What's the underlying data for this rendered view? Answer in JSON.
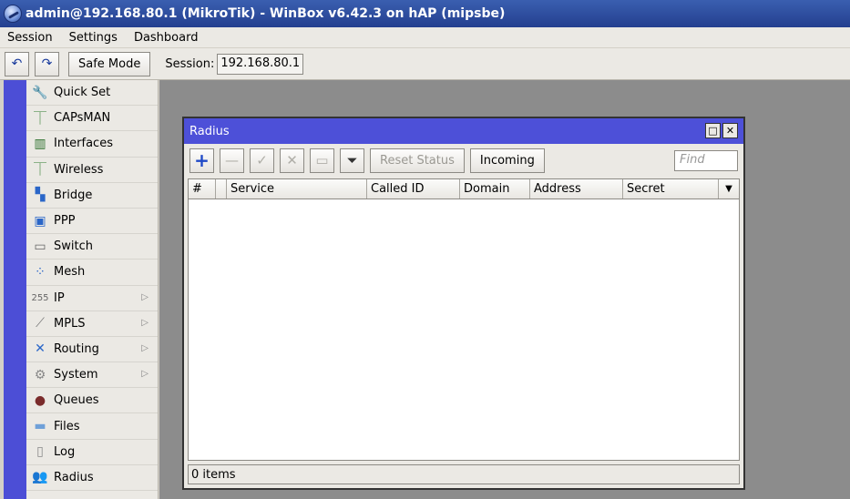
{
  "window_title": "admin@192.168.80.1 (MikroTik) - WinBox v6.42.3 on hAP (mipsbe)",
  "menu": [
    "Session",
    "Settings",
    "Dashboard"
  ],
  "toolbar": {
    "safe_mode": "Safe Mode",
    "session_label": "Session:",
    "session_value": "192.168.80.1"
  },
  "sidebar": {
    "items": [
      {
        "label": "Quick Set",
        "icon": "quickset-icon"
      },
      {
        "label": "CAPsMAN",
        "icon": "capsman-icon"
      },
      {
        "label": "Interfaces",
        "icon": "interfaces-icon"
      },
      {
        "label": "Wireless",
        "icon": "wireless-icon"
      },
      {
        "label": "Bridge",
        "icon": "bridge-icon"
      },
      {
        "label": "PPP",
        "icon": "ppp-icon"
      },
      {
        "label": "Switch",
        "icon": "switch-icon"
      },
      {
        "label": "Mesh",
        "icon": "mesh-icon"
      },
      {
        "label": "IP",
        "icon": "ip-icon",
        "submenu": true
      },
      {
        "label": "MPLS",
        "icon": "mpls-icon",
        "submenu": true
      },
      {
        "label": "Routing",
        "icon": "routing-icon",
        "submenu": true
      },
      {
        "label": "System",
        "icon": "system-icon",
        "submenu": true
      },
      {
        "label": "Queues",
        "icon": "queues-icon"
      },
      {
        "label": "Files",
        "icon": "files-icon"
      },
      {
        "label": "Log",
        "icon": "log-icon"
      },
      {
        "label": "Radius",
        "icon": "radius-icon"
      }
    ]
  },
  "radius_window": {
    "title": "Radius",
    "buttons": {
      "reset_status": "Reset Status",
      "incoming": "Incoming"
    },
    "find_placeholder": "Find",
    "columns": [
      "#",
      "Service",
      "Called ID",
      "Domain",
      "Address",
      "Secret"
    ],
    "status": "0 items"
  },
  "colors": {
    "title_bar": "#2b4796",
    "window_title": "#4d50d8",
    "left_strip": "#4c4ed6",
    "workspace": "#8c8c8c"
  }
}
